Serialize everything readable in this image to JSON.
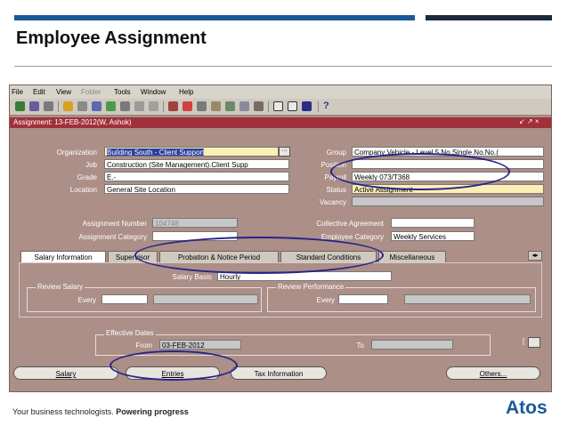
{
  "slide": {
    "title": "Employee Assignment",
    "footer_tagline": "Your business technologists.",
    "footer_emphasis": "Powering progress",
    "logo": "Atos"
  },
  "menu": [
    "File",
    "Edit",
    "View",
    "Folder",
    "Tools",
    "Window",
    "Help"
  ],
  "window_title": "Assignment: 13-FEB-2012(W, Ashok)",
  "form": {
    "organization": {
      "label": "Organization",
      "value": "Building South - Client Support"
    },
    "job": {
      "label": "Job",
      "value": "Construction (Site Management).Client Supp"
    },
    "grade": {
      "label": "Grade",
      "value": "E.-"
    },
    "location": {
      "label": "Location",
      "value": "General Site Location"
    },
    "group": {
      "label": "Group",
      "value": "Company Vehicle - Level 5.No.Single.No.No.("
    },
    "position": {
      "label": "Position",
      "value": ""
    },
    "payroll": {
      "label": "Payroll",
      "value": "Weekly 073/T368"
    },
    "status": {
      "label": "Status",
      "value": "Active Assignment"
    },
    "vacancy": {
      "label": "Vacancy",
      "value": ""
    },
    "assignment_number": {
      "label": "Assignment Number",
      "value": "104748"
    },
    "assignment_category": {
      "label": "Assignment Category",
      "value": ""
    },
    "collective_agreement": {
      "label": "Collective Agreement",
      "value": ""
    },
    "employee_category": {
      "label": "Employee Category",
      "value": "Weekly Services"
    }
  },
  "tabs": [
    "Salary Information",
    "Supervisor",
    "Probation & Notice Period",
    "Standard Conditions",
    "Miscellaneous"
  ],
  "salary": {
    "basis_label": "Salary Basis",
    "basis_value": "Hourly",
    "review_salary": "Review Salary",
    "review_performance": "Review Performance",
    "every": "Every"
  },
  "effective_dates": {
    "label": "Effective Dates",
    "from_label": "From",
    "from_value": "03-FEB-2012",
    "to_label": "To",
    "to_value": ""
  },
  "buttons": {
    "salary": "Salary",
    "entries": "Entries",
    "tax": "Tax Information",
    "others": "Others..."
  },
  "colors": {
    "accent_blue": "#1a5a96",
    "form_bg": "#ac8f87",
    "title_bar": "#a0303a",
    "highlight_oval": "#27238a"
  }
}
